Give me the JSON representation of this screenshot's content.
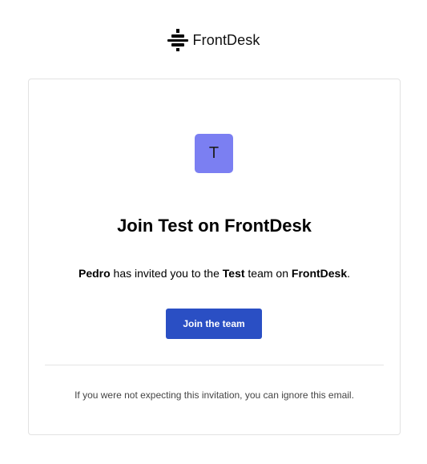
{
  "brand": {
    "name": "FrontDesk",
    "logo_icon": "frontdesk-logo-icon"
  },
  "invite": {
    "avatar_letter": "T",
    "heading": {
      "prefix": "Join ",
      "team": "Test",
      "middle": " on ",
      "product": "FrontDesk"
    },
    "message": {
      "inviter": "Pedro",
      "part1": " has invited you to the ",
      "team": "Test",
      "part2": " team on ",
      "product": "FrontDesk",
      "end": "."
    },
    "button_label": "Join the team",
    "footer": "If you were not expecting this invitation, you can ignore this email."
  },
  "colors": {
    "avatar_bg": "#7b7ff2",
    "button_bg": "#2a4fc4",
    "card_border": "#e2e2e2"
  }
}
